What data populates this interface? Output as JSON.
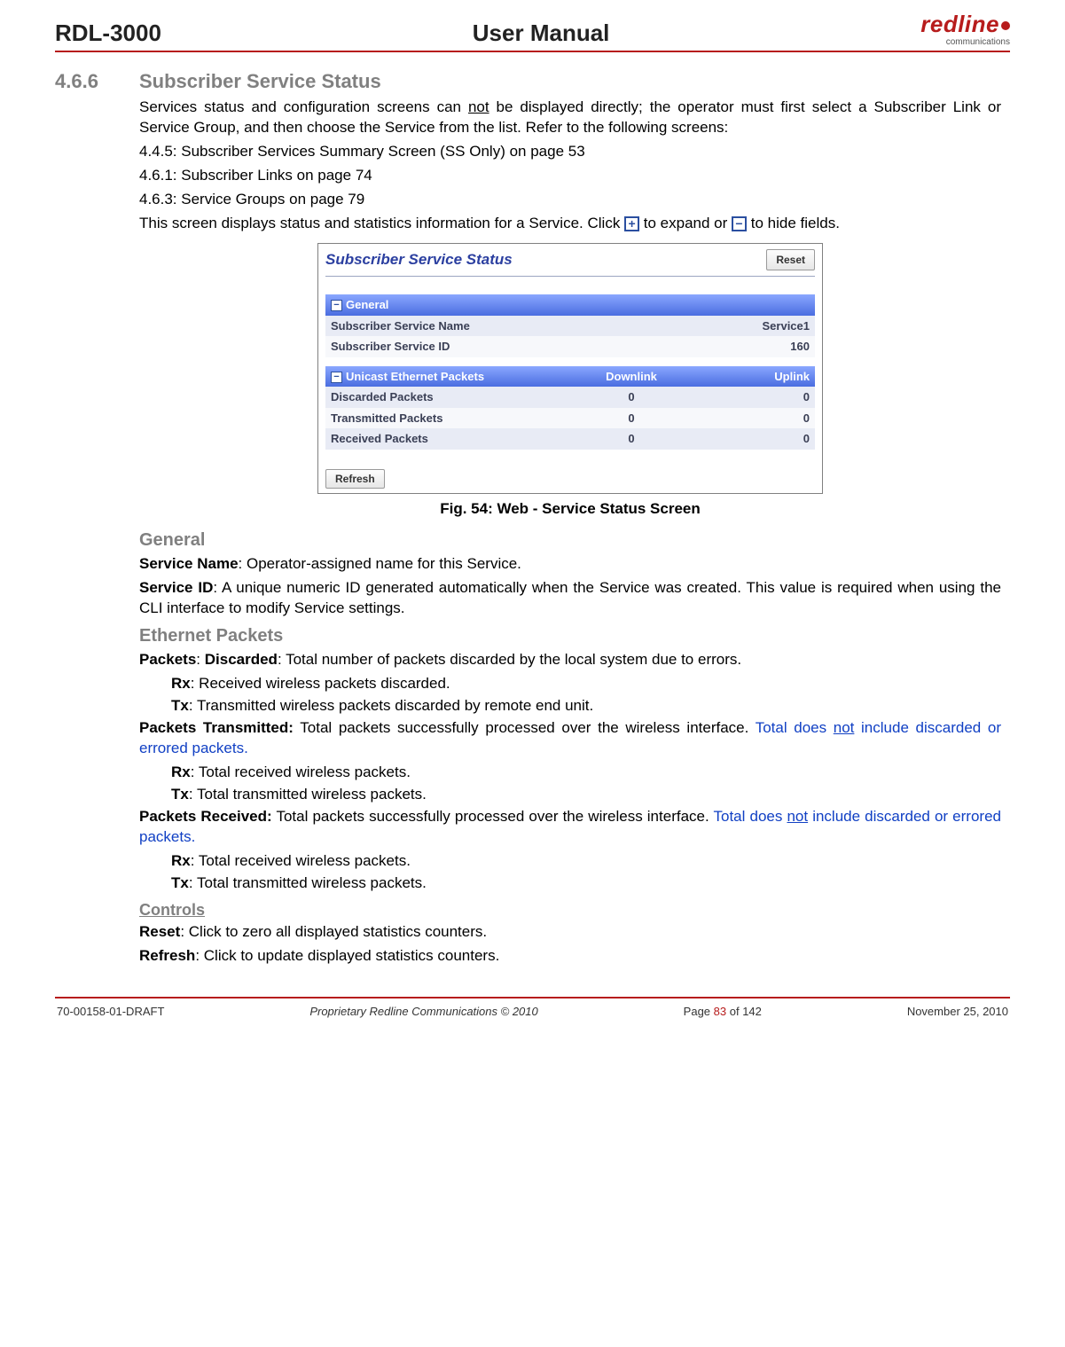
{
  "header": {
    "left": "RDL-3000",
    "center": "User Manual",
    "logo_main": "redline",
    "logo_sub": "communications"
  },
  "section": {
    "num": "4.6.6",
    "title": "Subscriber Service Status",
    "intro_a": "Services status and configuration screens can ",
    "intro_not": "not",
    "intro_b": " be displayed directly; the operator must first select a Subscriber Link or Service Group, and then choose the Service from the list. Refer to the following screens:",
    "ref1": "4.4.5: Subscriber Services Summary Screen (SS Only) on page 53",
    "ref2": "4.6.1: Subscriber Links on page 74",
    "ref3": "4.6.3: Service Groups on page 79",
    "desc_a": "This screen displays status and statistics information for a Service. Click ",
    "desc_b": " to expand or ",
    "desc_c": " to hide fields."
  },
  "screenshot": {
    "title": "Subscriber Service Status",
    "reset": "Reset",
    "refresh": "Refresh",
    "general_hdr": "General",
    "row1_label": "Subscriber Service Name",
    "row1_val": "Service1",
    "row2_label": "Subscriber Service ID",
    "row2_val": "160",
    "pkt_hdr": "Unicast Ethernet Packets",
    "col_dl": "Downlink",
    "col_ul": "Uplink",
    "r_disc": "Discarded Packets",
    "r_tx": "Transmitted Packets",
    "r_rx": "Received Packets",
    "v0": "0"
  },
  "caption": {
    "label": "Fig. 54",
    "text": ": Web - Service Status Screen"
  },
  "general": {
    "heading": "General",
    "svc_name_lbl": "Service Name",
    "svc_name_txt": ": Operator-assigned name for this Service.",
    "svc_id_lbl": "Service ID",
    "svc_id_txt": ": A unique numeric ID generated automatically when the Service was created. This value is required when using the CLI interface to modify Service settings."
  },
  "ethernet": {
    "heading": "Ethernet Packets",
    "disc_lbl": "Packets",
    "disc_lbl2": "Discarded",
    "disc_txt": ": Total number of packets discarded by the local system due to errors.",
    "rx_lbl": "Rx",
    "tx_lbl": "Tx",
    "disc_rx": ": Received wireless packets discarded.",
    "disc_tx": ": Transmitted wireless packets discarded by remote end unit.",
    "txm_lbl": "Packets Transmitted:",
    "txm_txt": " Total packets successfully processed over the wireless interface. ",
    "note_a": "Total does ",
    "note_not": "not",
    "note_b": " include discarded or errored packets.",
    "txm_rx": ": Total received wireless packets.",
    "txm_tx": ": Total transmitted wireless packets.",
    "rxv_lbl": "Packets Received:",
    "rxv_txt": " Total packets successfully processed over the wireless interface. "
  },
  "controls": {
    "heading": "Controls",
    "reset_lbl": "Reset",
    "reset_txt": ": Click to zero all displayed statistics counters.",
    "refresh_lbl": "Refresh",
    "refresh_txt": ": Click to update displayed statistics counters."
  },
  "footer": {
    "left": "70-00158-01-DRAFT",
    "mid": "Proprietary Redline Communications © 2010",
    "page_a": "Page ",
    "page_cur": "83",
    "page_b": " of 142",
    "date": "November 25, 2010"
  }
}
